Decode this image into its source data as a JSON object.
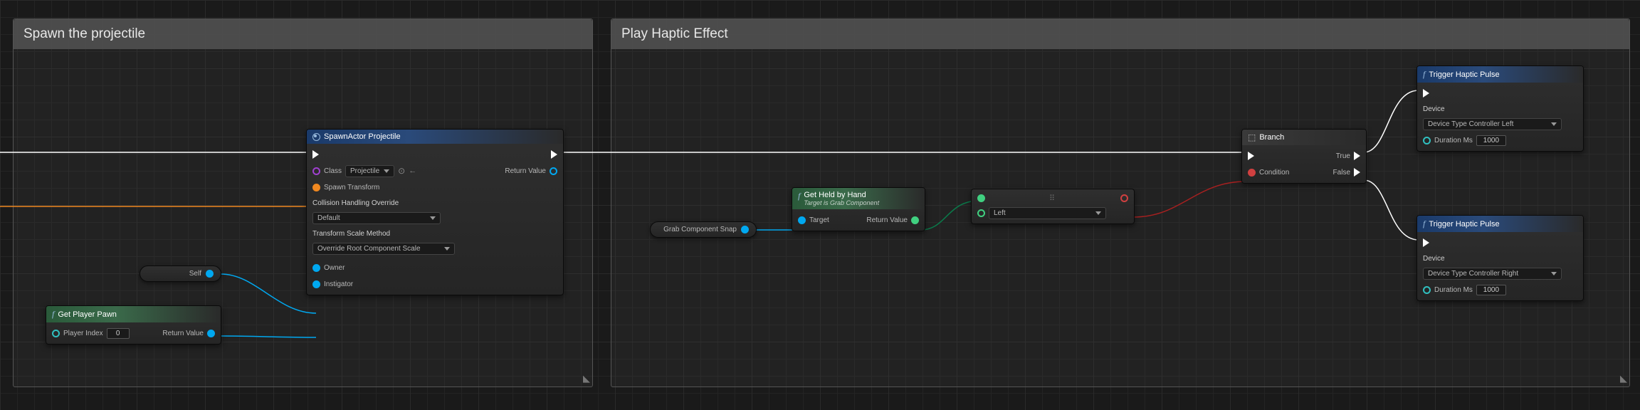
{
  "comments": {
    "spawn": "Spawn the projectile",
    "haptic": "Play Haptic Effect"
  },
  "nodes": {
    "spawnActor": {
      "title": "SpawnActor Projectile",
      "classLabel": "Class",
      "classValue": "Projectile",
      "spawnTransform": "Spawn Transform",
      "collisionHead": "Collision Handling Override",
      "collisionValue": "Default",
      "scaleHead": "Transform Scale Method",
      "scaleValue": "Override Root Component Scale",
      "owner": "Owner",
      "instigator": "Instigator",
      "returnValue": "Return Value"
    },
    "self": {
      "label": "Self"
    },
    "getPlayerPawn": {
      "title": "Get Player Pawn",
      "playerIndex": "Player Index",
      "playerIndexVal": "0",
      "returnValue": "Return Value"
    },
    "grabSnap": {
      "label": "Grab Component Snap"
    },
    "getHeld": {
      "title": "Get Held by Hand",
      "subtitle": "Target is Grab Component",
      "target": "Target",
      "returnValue": "Return Value"
    },
    "leftSwitch": {
      "value": "Left"
    },
    "branch": {
      "title": "Branch",
      "condition": "Condition",
      "true": "True",
      "false": "False"
    },
    "hapticTop": {
      "title": "Trigger Haptic Pulse",
      "device": "Device",
      "deviceValue": "Device Type Controller Left",
      "duration": "Duration Ms",
      "durationValue": "1000"
    },
    "hapticBottom": {
      "title": "Trigger Haptic Pulse",
      "device": "Device",
      "deviceValue": "Device Type Controller Right",
      "duration": "Duration Ms",
      "durationValue": "1000"
    }
  }
}
